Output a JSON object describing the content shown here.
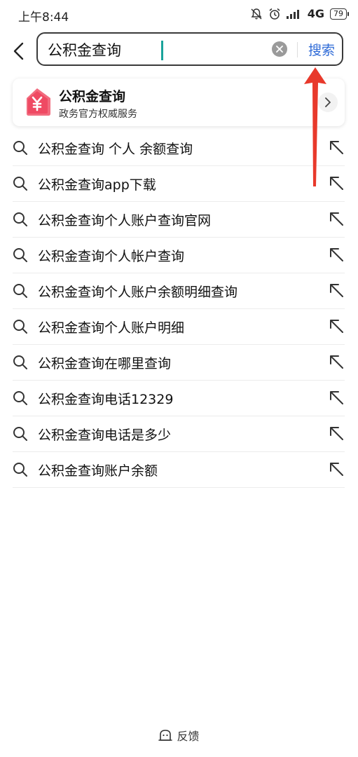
{
  "status_bar": {
    "time": "上午8:44",
    "network": "4G",
    "battery": "79"
  },
  "search": {
    "query": "公积金查询",
    "button_label": "搜索"
  },
  "service_card": {
    "title": "公积金查询",
    "subtitle": "政务官方权威服务",
    "logo_icon": "yuan-house-icon",
    "logo_color": "#ef4a63"
  },
  "suggestions": [
    {
      "text": "公积金查询 个人 余额查询"
    },
    {
      "text": "公积金查询app下载"
    },
    {
      "text": "公积金查询个人账户查询官网"
    },
    {
      "text": "公积金查询个人帐户查询"
    },
    {
      "text": "公积金查询个人账户余额明细查询"
    },
    {
      "text": "公积金查询个人账户明细"
    },
    {
      "text": "公积金查询在哪里查询"
    },
    {
      "text": "公积金查询电话12329"
    },
    {
      "text": "公积金查询电话是多少"
    },
    {
      "text": "公积金查询账户余额"
    }
  ],
  "feedback": {
    "label": "反馈"
  },
  "colors": {
    "accent": "#2f6bd7",
    "annotation": "#e8392b",
    "caret": "#1aa39b"
  }
}
